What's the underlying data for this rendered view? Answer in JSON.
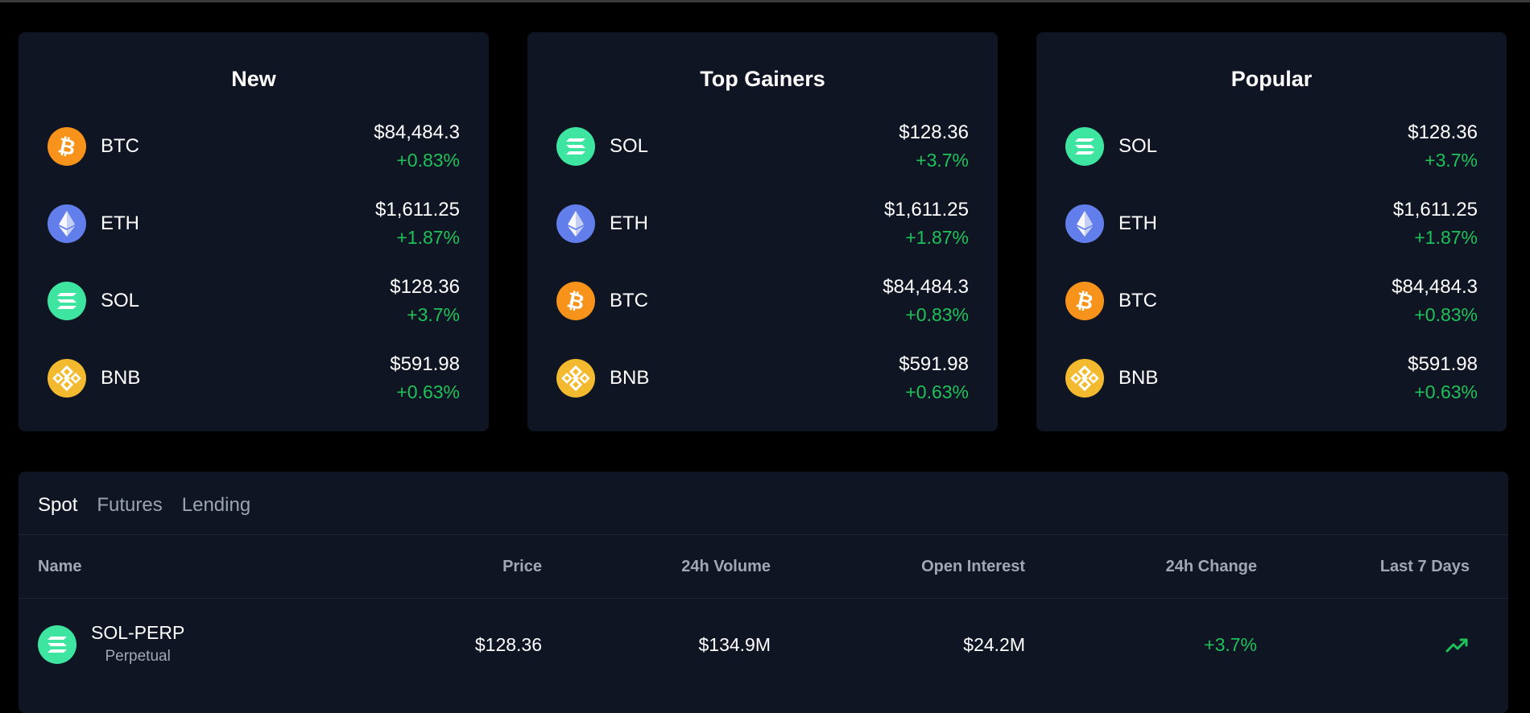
{
  "colors": {
    "background": "#000000",
    "card": "#0f1523",
    "positive": "#1ec15a",
    "muted": "#a0a8b5"
  },
  "cards": [
    {
      "title": "New",
      "coins": [
        {
          "symbol": "BTC",
          "icon": "bitcoin-icon",
          "price": "$84,484.3",
          "change": "+0.83%"
        },
        {
          "symbol": "ETH",
          "icon": "ethereum-icon",
          "price": "$1,611.25",
          "change": "+1.87%"
        },
        {
          "symbol": "SOL",
          "icon": "solana-icon",
          "price": "$128.36",
          "change": "+3.7%"
        },
        {
          "symbol": "BNB",
          "icon": "bnb-icon",
          "price": "$591.98",
          "change": "+0.63%"
        }
      ]
    },
    {
      "title": "Top Gainers",
      "coins": [
        {
          "symbol": "SOL",
          "icon": "solana-icon",
          "price": "$128.36",
          "change": "+3.7%"
        },
        {
          "symbol": "ETH",
          "icon": "ethereum-icon",
          "price": "$1,611.25",
          "change": "+1.87%"
        },
        {
          "symbol": "BTC",
          "icon": "bitcoin-icon",
          "price": "$84,484.3",
          "change": "+0.83%"
        },
        {
          "symbol": "BNB",
          "icon": "bnb-icon",
          "price": "$591.98",
          "change": "+0.63%"
        }
      ]
    },
    {
      "title": "Popular",
      "coins": [
        {
          "symbol": "SOL",
          "icon": "solana-icon",
          "price": "$128.36",
          "change": "+3.7%"
        },
        {
          "symbol": "ETH",
          "icon": "ethereum-icon",
          "price": "$1,611.25",
          "change": "+1.87%"
        },
        {
          "symbol": "BTC",
          "icon": "bitcoin-icon",
          "price": "$84,484.3",
          "change": "+0.83%"
        },
        {
          "symbol": "BNB",
          "icon": "bnb-icon",
          "price": "$591.98",
          "change": "+0.63%"
        }
      ]
    }
  ],
  "markets": {
    "tabs": [
      {
        "label": "Spot",
        "active": true
      },
      {
        "label": "Futures",
        "active": false
      },
      {
        "label": "Lending",
        "active": false
      }
    ],
    "columns": [
      "Name",
      "Price",
      "24h Volume",
      "Open Interest",
      "24h Change",
      "Last 7 Days"
    ],
    "rows": [
      {
        "pair": "SOL-PERP",
        "type": "Perpetual",
        "icon": "solana-icon",
        "price": "$128.36",
        "volume": "$134.9M",
        "open_interest": "$24.2M",
        "change": "+3.7%",
        "trend_icon": "trending-up-icon"
      }
    ]
  }
}
